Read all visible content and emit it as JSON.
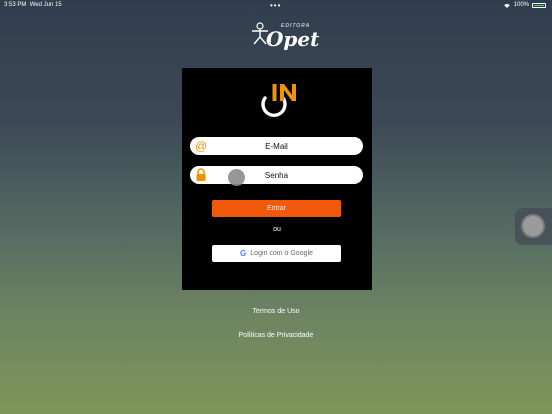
{
  "status_bar": {
    "time": "3:53 PM",
    "date": "Wed Jun 15",
    "dots": "•••",
    "battery_percent": "100%"
  },
  "brand": {
    "editora": "EDITORA",
    "name": "Opet"
  },
  "login": {
    "email_placeholder": "E-Mail",
    "senha_placeholder": "Senha",
    "entrar_label": "Entrar",
    "ou_label": "ou",
    "google_label": "Login com o Google"
  },
  "footer": {
    "termos": "Termos de Uso",
    "politicas": "Políticas de Privacidade"
  },
  "colors": {
    "accent": "#f15a0c",
    "icon_orange": "#f39200"
  }
}
